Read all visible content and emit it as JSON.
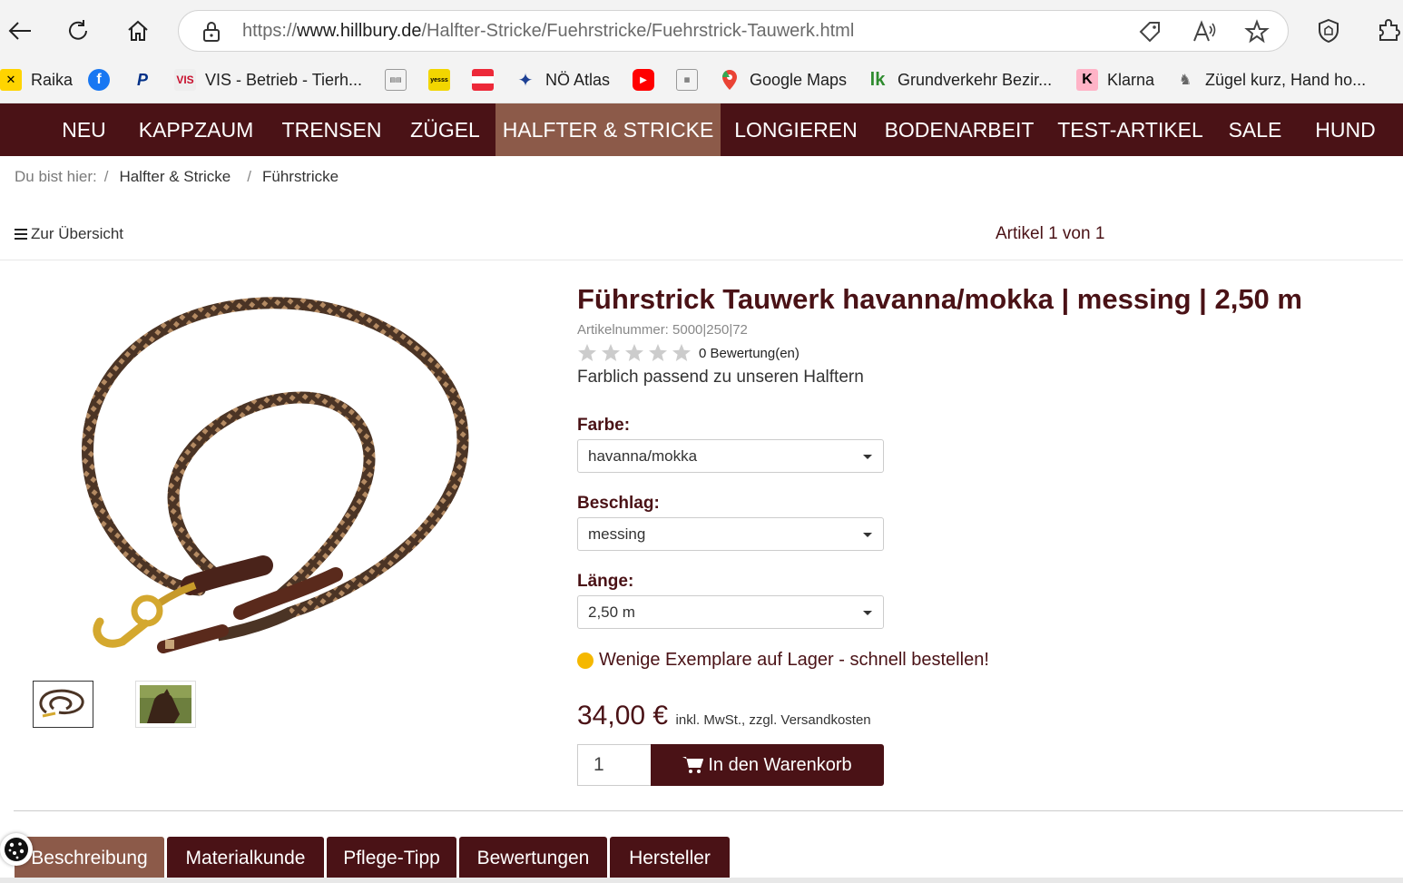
{
  "browser": {
    "url_prefix": "https://",
    "url_host": "www.hillbury.de",
    "url_path": "/Halfter-Stricke/Fuehrstricke/Fuehrstrick-Tauwerk.html"
  },
  "bookmarks": [
    {
      "label": "Raika",
      "icon": "raika-icon",
      "color": "#ffd400"
    },
    {
      "label": "",
      "icon": "facebook-icon",
      "color": "#1877f2"
    },
    {
      "label": "",
      "icon": "paypal-icon",
      "color": "#003087"
    },
    {
      "label": "VIS - Betrieb - Tierh...",
      "icon": "vis-icon",
      "color": "#c8102e"
    },
    {
      "label": "",
      "icon": "generic-site-icon",
      "color": "#888888"
    },
    {
      "label": "",
      "icon": "yesss-icon",
      "color": "#f2d600"
    },
    {
      "label": "",
      "icon": "austria-flag-icon",
      "color": "#ed2939"
    },
    {
      "label": "NÖ Atlas",
      "icon": "atlas-icon",
      "color": "#1c3f94"
    },
    {
      "label": "",
      "icon": "youtube-icon",
      "color": "#ff0000"
    },
    {
      "label": "",
      "icon": "grid-site-icon",
      "color": "#777777"
    },
    {
      "label": "Google Maps",
      "icon": "google-maps-icon",
      "color": "#34a853"
    },
    {
      "label": "Grundverkehr Bezir...",
      "icon": "lk-icon",
      "color": "#2e8b2e"
    },
    {
      "label": "Klarna",
      "icon": "klarna-icon",
      "color": "#ffb3c7"
    },
    {
      "label": "Zügel kurz, Hand ho...",
      "icon": "horse-icon",
      "color": "#666666"
    }
  ],
  "nav": {
    "items": [
      "NEU",
      "KAPPZAUM",
      "TRENSEN",
      "ZÜGEL",
      "HALFTER & STRICKE",
      "LONGIEREN",
      "BODENARBEIT",
      "TEST-ARTIKEL",
      "SALE",
      "HUND"
    ],
    "active": "HALFTER & STRICKE"
  },
  "breadcrumb": {
    "prefix": "Du bist hier:",
    "items": [
      "Halfter & Stricke",
      "Führstricke"
    ]
  },
  "overview": {
    "back_label": "Zur Übersicht",
    "count_label": "Artikel 1 von 1"
  },
  "product": {
    "title": "Führstrick Tauwerk havanna/mokka | messing | 2,50 m",
    "sku": "Artikelnummer: 5000|250|72",
    "rating": {
      "value": 0,
      "max": 5,
      "label": "0 Bewertung(en)"
    },
    "short_desc": "Farblich passend zu unseren Halftern",
    "options": [
      {
        "label": "Farbe:",
        "value": "havanna/mokka"
      },
      {
        "label": "Beschlag:",
        "value": "messing"
      },
      {
        "label": "Länge:",
        "value": "2,50 m"
      }
    ],
    "stock_text": "Wenige Exemplare auf Lager - schnell bestellen!",
    "price": "34,00 €",
    "tax_note": "inkl. MwSt., zzgl. Versandkosten",
    "quantity": "1",
    "cart_label": "In den Warenkorb"
  },
  "tabs": [
    "Beschreibung",
    "Materialkunde",
    "Pflege-Tipp",
    "Bewertungen",
    "Hersteller"
  ],
  "colors": {
    "brand": "#4a1216",
    "active": "#8c5a49",
    "stock": "#f5b800"
  }
}
